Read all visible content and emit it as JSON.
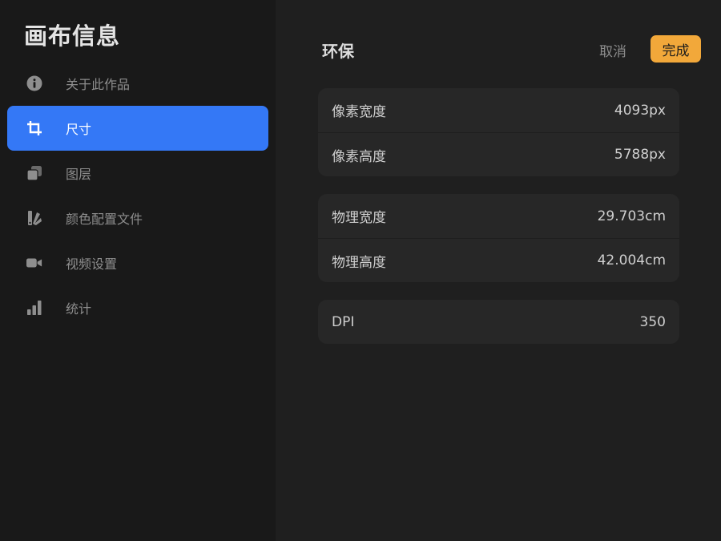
{
  "sidebar": {
    "title": "画布信息",
    "items": [
      {
        "label": "关于此作品",
        "icon": "info-icon"
      },
      {
        "label": "尺寸",
        "icon": "crop-icon"
      },
      {
        "label": "图层",
        "icon": "layers-icon"
      },
      {
        "label": "颜色配置文件",
        "icon": "color-profile-icon"
      },
      {
        "label": "视频设置",
        "icon": "video-camera-icon"
      },
      {
        "label": "统计",
        "icon": "bar-chart-icon"
      }
    ],
    "active_index": 1
  },
  "main": {
    "title": "环保",
    "cancel_label": "取消",
    "done_label": "完成",
    "pixel_group": {
      "width_label": "像素宽度",
      "width_value": "4093px",
      "height_label": "像素高度",
      "height_value": "5788px"
    },
    "physical_group": {
      "width_label": "物理宽度",
      "width_value": "29.703cm",
      "height_label": "物理高度",
      "height_value": "42.004cm"
    },
    "dpi_group": {
      "label": "DPI",
      "value": "350"
    }
  },
  "colors": {
    "accent": "#3478f6",
    "done_button": "#f2a83a",
    "background": "#1f1f1f",
    "sidebar_background": "#191919"
  }
}
